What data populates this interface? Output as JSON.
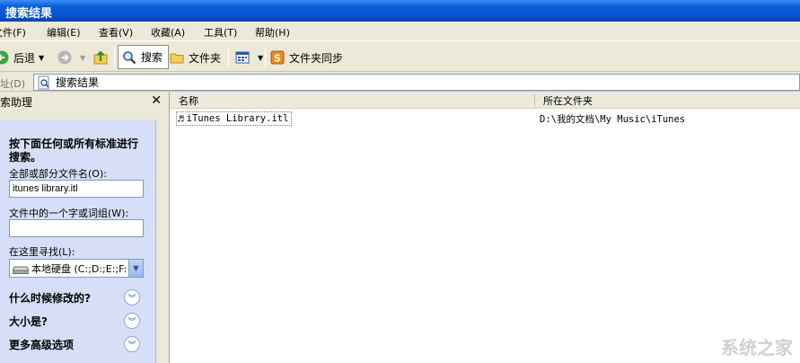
{
  "window": {
    "title": "搜索结果"
  },
  "menu": [
    "文件(F)",
    "编辑(E)",
    "查看(V)",
    "收藏(A)",
    "工具(T)",
    "帮助(H)"
  ],
  "toolbar": {
    "back_label": "后退",
    "search_label": "搜索",
    "folders_label": "文件夹",
    "sync_label": "文件夹同步",
    "icons": {
      "back": "back-arrow-icon",
      "forward": "forward-arrow-icon",
      "up": "up-folder-icon",
      "search": "magnifier-icon",
      "folders": "folder-icon",
      "views": "views-icon",
      "sync": "sync-icon"
    }
  },
  "address": {
    "label": "地址(D)",
    "value": "搜索结果"
  },
  "search_pane": {
    "title": "搜索助理",
    "heading": "按下面任何或所有标准进行搜索。",
    "filename_label": "全部或部分文件名(O):",
    "filename_value": "itunes library.itl",
    "phrase_label": "文件中的一个字或词组(W):",
    "phrase_value": "",
    "lookin_label": "在这里寻找(L):",
    "lookin_value": "本地硬盘 (C:;D:;E:;F:",
    "options": [
      "什么时候修改的?",
      "大小是?",
      "更多高级选项"
    ]
  },
  "results": {
    "columns": [
      "名称",
      "所在文件夹"
    ],
    "rows": [
      {
        "name": "iTunes Library.itl",
        "folder": "D:\\我的文档\\My Music\\iTunes"
      }
    ]
  },
  "watermark": "系统之家"
}
